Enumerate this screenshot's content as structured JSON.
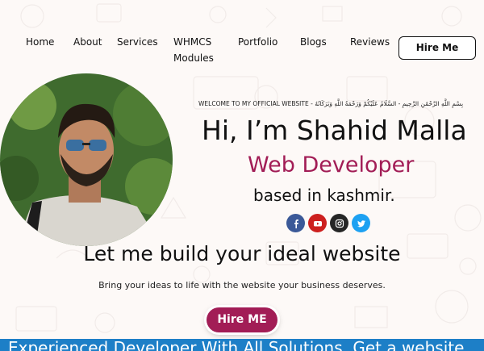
{
  "nav": {
    "items": [
      {
        "label": "Home"
      },
      {
        "label": "About"
      },
      {
        "label": "Services"
      },
      {
        "label": "WHMCS"
      },
      {
        "label": "Modules"
      },
      {
        "label": "Portfolio"
      },
      {
        "label": "Blogs"
      },
      {
        "label": "Reviews"
      }
    ],
    "hire_button": "Hire Me"
  },
  "hero": {
    "welcome": "WELCOME TO MY OFFICIAL WEBSITE - بِسْمِ اللَّهِ الرَّحْمَٰنِ الرَّحِيمِ - السَّلَامُ عَلَيْكُمْ وَرَحْمَةُ اللَّهِ وَبَرَكَاتُهُ",
    "greeting": "Hi, I’m Shahid Malla",
    "role": "Web Developer",
    "location": "based in kashmir.",
    "socials": [
      {
        "icon": "facebook-icon",
        "color": "#3b5998"
      },
      {
        "icon": "youtube-icon",
        "color": "#cd201f"
      },
      {
        "icon": "instagram-icon",
        "color": "#262626"
      },
      {
        "icon": "twitter-icon",
        "color": "#1da1f2"
      }
    ]
  },
  "main": {
    "headline": "Let me build your ideal website",
    "subline": "Bring your ideas to life with the website your business deserves.",
    "cta": "Hire ME"
  },
  "banner": {
    "text": "Experienced Developer With All Solutions. Get a website"
  },
  "colors": {
    "accent": "#a21d56",
    "banner": "#1d7fc7",
    "background": "#fdf9f7"
  }
}
